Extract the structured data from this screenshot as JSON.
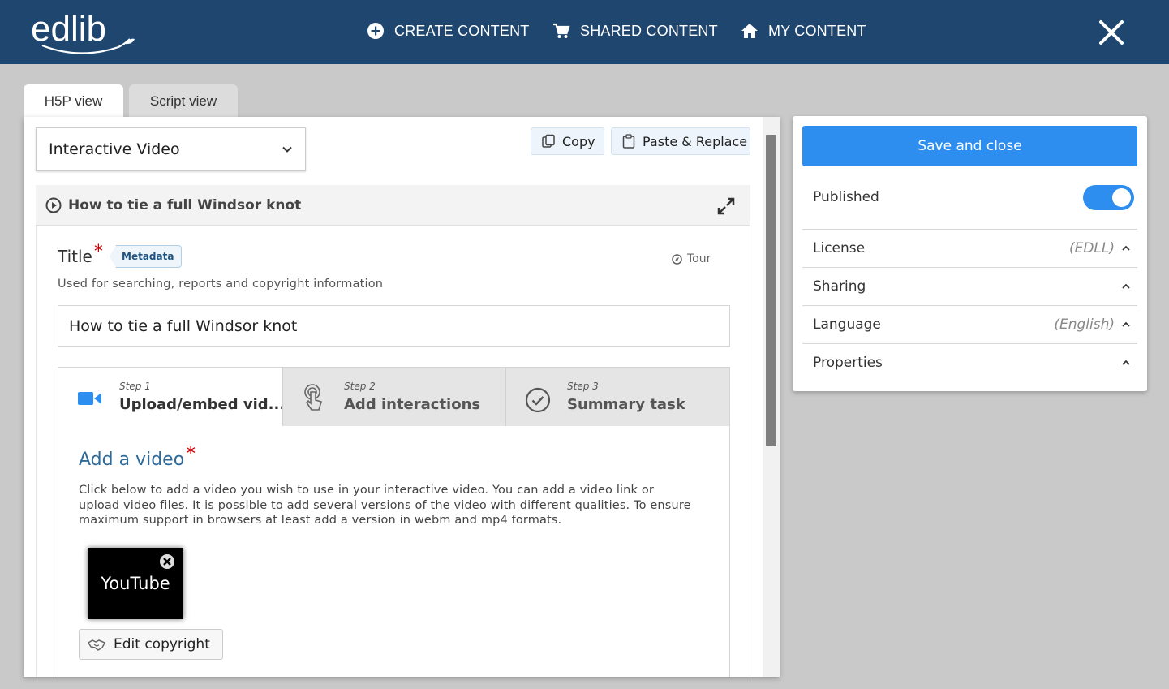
{
  "app": {
    "logo_text": "edlib"
  },
  "nav": {
    "create": "CREATE CONTENT",
    "shared": "SHARED CONTENT",
    "mine": "MY CONTENT"
  },
  "view_tabs": {
    "h5p": "H5P view",
    "script": "Script view"
  },
  "editor": {
    "content_type": "Interactive Video",
    "copy_label": "Copy",
    "paste_label": "Paste & Replace",
    "section_title": "How to tie a full Windsor knot",
    "title_label": "Title",
    "required_mark": "*",
    "metadata_label": "Metadata",
    "tour_label": "Tour",
    "title_description": "Used for searching, reports and copyright information",
    "title_value": "How to tie a full Windsor knot",
    "steps": [
      {
        "num": "Step 1",
        "name": "Upload/embed vid..."
      },
      {
        "num": "Step 2",
        "name": "Add interactions"
      },
      {
        "num": "Step 3",
        "name": "Summary task"
      }
    ],
    "add_video_heading": "Add a video",
    "add_video_lines": [
      "Click below to add a video you wish to use in your interactive video. You can add a video link or",
      "upload video files. It is possible to add several versions of the video with different qualities. To ensure",
      "maximum support in browsers at least add a version in webm and mp4 formats."
    ],
    "video_thumb_label": "YouTube",
    "edit_copyright_label": "Edit copyright"
  },
  "side": {
    "save_label": "Save and close",
    "published_label": "Published",
    "published": true,
    "accordion": [
      {
        "label": "License",
        "value": "(EDLL)"
      },
      {
        "label": "Sharing",
        "value": ""
      },
      {
        "label": "Language",
        "value": "(English)"
      },
      {
        "label": "Properties",
        "value": ""
      }
    ]
  },
  "colors": {
    "header_bg": "#1f466e",
    "accent_blue": "#2d8ef0",
    "heading_blue": "#2e6a99",
    "required_red": "#cc0000",
    "page_bg": "#c9c9c9"
  },
  "icons": {
    "create": "plus-circle-icon",
    "shared": "cart-icon",
    "mine": "home-icon",
    "close": "close-icon",
    "copy": "copy-icon",
    "paste": "clipboard-icon",
    "play": "play-circle-icon",
    "expand": "expand-icon",
    "tour": "compass-icon",
    "step1": "video-camera-icon",
    "step2": "tap-hand-icon",
    "step3": "check-circle-icon",
    "edit_copyright": "handshake-icon"
  }
}
